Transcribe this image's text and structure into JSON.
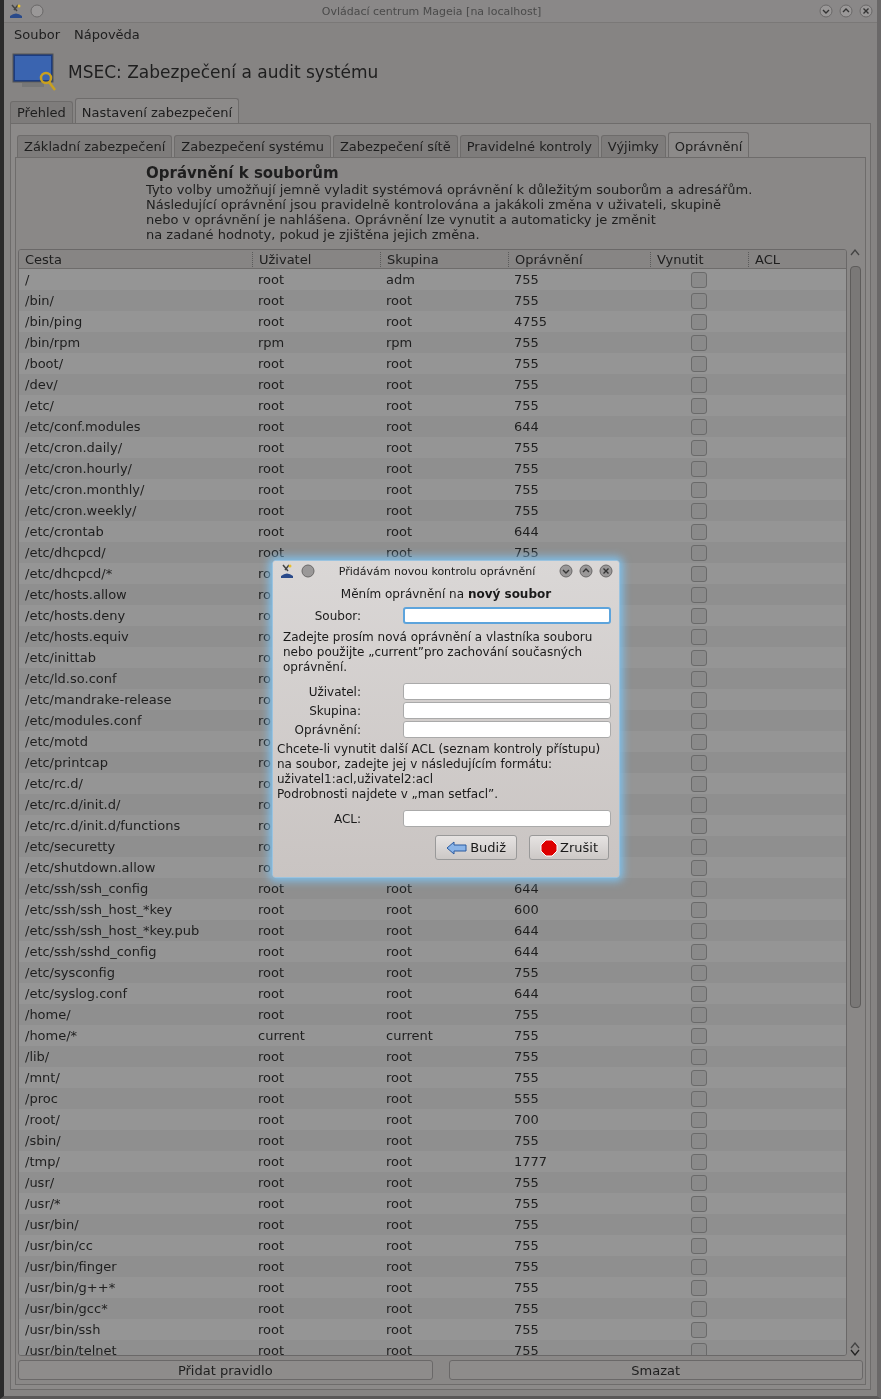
{
  "window": {
    "title": "Ovládací centrum Mageia  [na localhost]"
  },
  "menu": [
    "Soubor",
    "Nápověda"
  ],
  "header": {
    "title": "MSEC: Zabezpečení a audit systému"
  },
  "tabs": [
    {
      "label": "Přehled",
      "selected": false
    },
    {
      "label": "Nastavení zabezpečení",
      "selected": true
    }
  ],
  "subtabs": [
    {
      "label": "Základní zabezpečení",
      "selected": false
    },
    {
      "label": "Zabezpečení systému",
      "selected": false
    },
    {
      "label": "Zabezpečení sítě",
      "selected": false
    },
    {
      "label": "Pravidelné kontroly",
      "selected": false
    },
    {
      "label": "Výjimky",
      "selected": false
    },
    {
      "label": "Oprávnění",
      "selected": true
    }
  ],
  "section": {
    "heading": "Oprávnění k souborům",
    "description": "Tyto volby umožňují jemně vyladit systémová oprávnění k důležitým souborům a adresářům.\nNásledující oprávnění jsou pravidelně kontrolována a jakákoli změna v uživateli, skupině\nnebo v oprávnění je nahlášena. Oprávnění lze vynutit a automaticky je změnit\nna zadané hodnoty, pokud je zjištěna jejich změna."
  },
  "table": {
    "columns": [
      "Cesta",
      "Uživatel",
      "Skupina",
      "Oprávnění",
      "Vynutit",
      "ACL"
    ],
    "rows": [
      {
        "path": "/",
        "user": "root",
        "group": "adm",
        "permission": "755",
        "forced": false
      },
      {
        "path": "/bin/",
        "user": "root",
        "group": "root",
        "permission": "755",
        "forced": false
      },
      {
        "path": "/bin/ping",
        "user": "root",
        "group": "root",
        "permission": "4755",
        "forced": false
      },
      {
        "path": "/bin/rpm",
        "user": "rpm",
        "group": "rpm",
        "permission": "755",
        "forced": false
      },
      {
        "path": "/boot/",
        "user": "root",
        "group": "root",
        "permission": "755",
        "forced": false
      },
      {
        "path": "/dev/",
        "user": "root",
        "group": "root",
        "permission": "755",
        "forced": false
      },
      {
        "path": "/etc/",
        "user": "root",
        "group": "root",
        "permission": "755",
        "forced": false
      },
      {
        "path": "/etc/conf.modules",
        "user": "root",
        "group": "root",
        "permission": "644",
        "forced": false
      },
      {
        "path": "/etc/cron.daily/",
        "user": "root",
        "group": "root",
        "permission": "755",
        "forced": false
      },
      {
        "path": "/etc/cron.hourly/",
        "user": "root",
        "group": "root",
        "permission": "755",
        "forced": false
      },
      {
        "path": "/etc/cron.monthly/",
        "user": "root",
        "group": "root",
        "permission": "755",
        "forced": false
      },
      {
        "path": "/etc/cron.weekly/",
        "user": "root",
        "group": "root",
        "permission": "755",
        "forced": false
      },
      {
        "path": "/etc/crontab",
        "user": "root",
        "group": "root",
        "permission": "644",
        "forced": false
      },
      {
        "path": "/etc/dhcpcd/",
        "user": "root",
        "group": "root",
        "permission": "755",
        "forced": false
      },
      {
        "path": "/etc/dhcpcd/*",
        "user": "ro",
        "forced": false
      },
      {
        "path": "/etc/hosts.allow",
        "user": "ro",
        "forced": false
      },
      {
        "path": "/etc/hosts.deny",
        "user": "ro",
        "forced": false
      },
      {
        "path": "/etc/hosts.equiv",
        "user": "ro",
        "forced": false
      },
      {
        "path": "/etc/inittab",
        "user": "ro",
        "forced": false
      },
      {
        "path": "/etc/ld.so.conf",
        "user": "ro",
        "forced": false
      },
      {
        "path": "/etc/mandrake-release",
        "user": "ro",
        "forced": false
      },
      {
        "path": "/etc/modules.conf",
        "user": "ro",
        "forced": false
      },
      {
        "path": "/etc/motd",
        "user": "ro",
        "forced": false
      },
      {
        "path": "/etc/printcap",
        "user": "ro",
        "forced": false
      },
      {
        "path": "/etc/rc.d/",
        "user": "ro",
        "forced": false
      },
      {
        "path": "/etc/rc.d/init.d/",
        "user": "ro",
        "forced": false
      },
      {
        "path": "/etc/rc.d/init.d/functions",
        "user": "ro",
        "forced": false
      },
      {
        "path": "/etc/securetty",
        "user": "ro",
        "forced": false
      },
      {
        "path": "/etc/shutdown.allow",
        "user": "ro",
        "forced": false
      },
      {
        "path": "/etc/ssh/ssh_config",
        "user": "root",
        "group": "root",
        "permission": "644",
        "forced": false
      },
      {
        "path": "/etc/ssh/ssh_host_*key",
        "user": "root",
        "group": "root",
        "permission": "600",
        "forced": false
      },
      {
        "path": "/etc/ssh/ssh_host_*key.pub",
        "user": "root",
        "group": "root",
        "permission": "644",
        "forced": false
      },
      {
        "path": "/etc/ssh/sshd_config",
        "user": "root",
        "group": "root",
        "permission": "644",
        "forced": false
      },
      {
        "path": "/etc/sysconfig",
        "user": "root",
        "group": "root",
        "permission": "755",
        "forced": false
      },
      {
        "path": "/etc/syslog.conf",
        "user": "root",
        "group": "root",
        "permission": "644",
        "forced": false
      },
      {
        "path": "/home/",
        "user": "root",
        "group": "root",
        "permission": "755",
        "forced": false
      },
      {
        "path": "/home/*",
        "user": "current",
        "group": "current",
        "permission": "755",
        "forced": false
      },
      {
        "path": "/lib/",
        "user": "root",
        "group": "root",
        "permission": "755",
        "forced": false
      },
      {
        "path": "/mnt/",
        "user": "root",
        "group": "root",
        "permission": "755",
        "forced": false
      },
      {
        "path": "/proc",
        "user": "root",
        "group": "root",
        "permission": "555",
        "forced": false
      },
      {
        "path": "/root/",
        "user": "root",
        "group": "root",
        "permission": "700",
        "forced": false
      },
      {
        "path": "/sbin/",
        "user": "root",
        "group": "root",
        "permission": "755",
        "forced": false
      },
      {
        "path": "/tmp/",
        "user": "root",
        "group": "root",
        "permission": "1777",
        "forced": false
      },
      {
        "path": "/usr/",
        "user": "root",
        "group": "root",
        "permission": "755",
        "forced": false
      },
      {
        "path": "/usr/*",
        "user": "root",
        "group": "root",
        "permission": "755",
        "forced": false
      },
      {
        "path": "/usr/bin/",
        "user": "root",
        "group": "root",
        "permission": "755",
        "forced": false
      },
      {
        "path": "/usr/bin/cc",
        "user": "root",
        "group": "root",
        "permission": "755",
        "forced": false
      },
      {
        "path": "/usr/bin/finger",
        "user": "root",
        "group": "root",
        "permission": "755",
        "forced": false
      },
      {
        "path": "/usr/bin/g++*",
        "user": "root",
        "group": "root",
        "permission": "755",
        "forced": false
      },
      {
        "path": "/usr/bin/gcc*",
        "user": "root",
        "group": "root",
        "permission": "755",
        "forced": false
      },
      {
        "path": "/usr/bin/ssh",
        "user": "root",
        "group": "root",
        "permission": "755",
        "forced": false
      },
      {
        "path": "/usr/bin/telnet",
        "user": "root",
        "group": "root",
        "permission": "755",
        "forced": false
      }
    ]
  },
  "buttons": [
    "Přidat pravidlo",
    "Smazat"
  ],
  "dialog": {
    "title": "Přidávám novou kontrolu oprávnění",
    "heading": "Měním oprávnění na **nový soubor**",
    "file_field": {
      "label": "Soubor:",
      "focused": true
    },
    "owner_hint": "Zadejte prosím nová oprávnění a vlastníka souboru\nnebo použijte „current”pro zachování současných\noprávnění.",
    "owner_fields": [
      {
        "label": "Uživatel:",
        "focused": false
      },
      {
        "label": "Skupina:",
        "focused": false
      },
      {
        "label": "Oprávnění:",
        "focused": false
      }
    ],
    "acl_hint": "Chcete-li vynutit další ACL (seznam kontroly přístupu)\nna soubor, zadejte jej v následujícím formátu:\nuživatel1:acl,uživatel2:acl\nPodrobnosti najdete v „man setfacl”.",
    "acl_field": {
      "label": "ACL:",
      "focused": false
    },
    "buttons": [
      {
        "label": "Budiž",
        "kind": "ok"
      },
      {
        "label": "Zrušit",
        "kind": "cancel"
      }
    ]
  }
}
